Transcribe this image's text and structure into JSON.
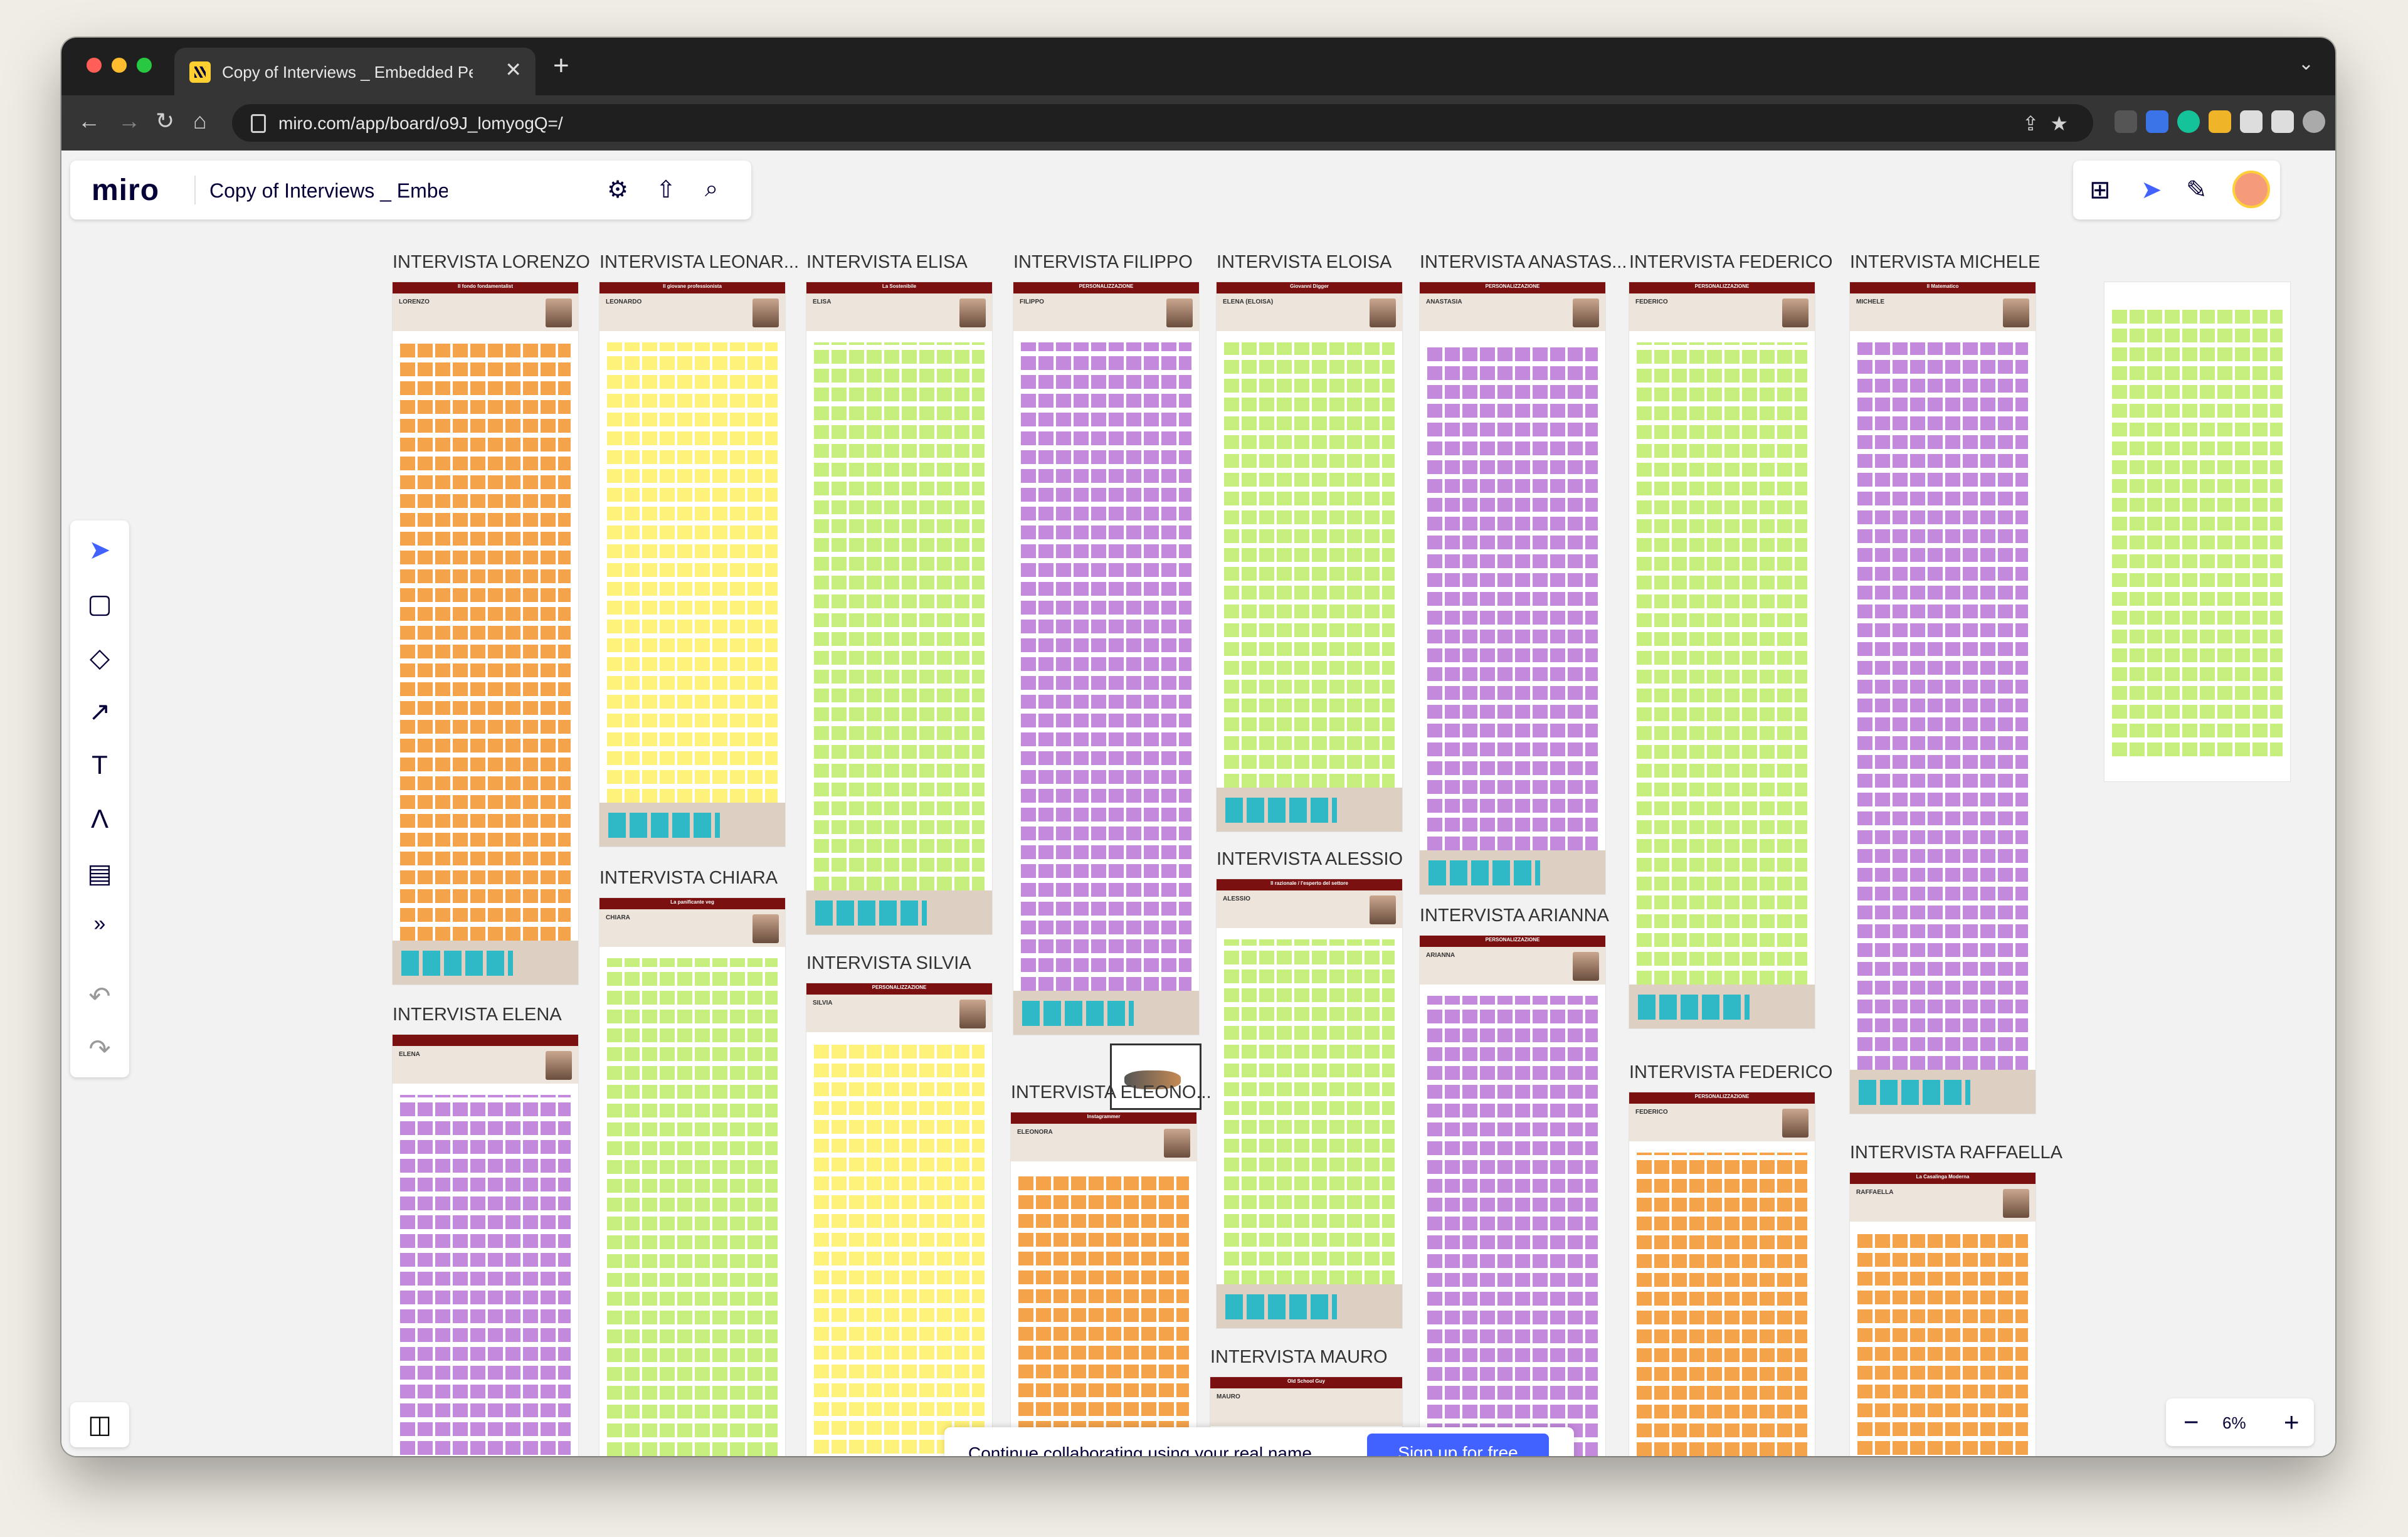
{
  "browser": {
    "tab_title": "Copy of Interviews _ Embedded Per",
    "new_tab_symbol": "+",
    "close_symbol": "✕",
    "url": "miro.com/app/board/o9J_lomyogQ=/"
  },
  "miro": {
    "logo": "miro",
    "board_name": "Copy of Interviews _ Embedded Per...",
    "zoom": "6%",
    "banner_text": "Continue collaborating using your real name.",
    "signup_label": "Sign up for free"
  },
  "frames": [
    {
      "title": "INTERVISTA LORENZO",
      "header": "Il fondo fondamentalist",
      "name": "LORENZO"
    },
    {
      "title": "INTERVISTA LEONAR...",
      "header": "Il giovane professionista",
      "name": "LEONARDO"
    },
    {
      "title": "INTERVISTA ELISA",
      "header": "La Sostenibile",
      "name": "ELISA"
    },
    {
      "title": "INTERVISTA FILIPPO",
      "header": "PERSONALIZZAZIONE",
      "name": "FILIPPO"
    },
    {
      "title": "INTERVISTA ELOISA",
      "header": "Giovanni Digger",
      "name": "ELENA (ELOISA)"
    },
    {
      "title": "INTERVISTA ANASTAS...",
      "header": "PERSONALIZZAZIONE",
      "name": "ANASTASIA"
    },
    {
      "title": "INTERVISTA FEDERICO",
      "header": "PERSONALIZZAZIONE",
      "name": "FEDERICO"
    },
    {
      "title": "INTERVISTA MICHELE",
      "header": "Il Matematico",
      "name": "MICHELE"
    },
    {
      "title": "INTERVISTA ELENA",
      "header": "",
      "name": "ELENA"
    },
    {
      "title": "INTERVISTA CHIARA",
      "header": "La panificante veg",
      "name": "CHIARA"
    },
    {
      "title": "INTERVISTA SILVIA",
      "header": "PERSONALIZZAZIONE",
      "name": "SILVIA"
    },
    {
      "title": "INTERVISTA ELEONO...",
      "header": "Instagrammer",
      "name": "ELEONORA"
    },
    {
      "title": "INTERVISTA ALESSIO",
      "header": "Il razionale / l'esperto del settore",
      "name": "ALESSIO"
    },
    {
      "title": "INTERVISTA ARIANNA",
      "header": "PERSONALIZZAZIONE",
      "name": "ARIANNA"
    },
    {
      "title": "INTERVISTA FEDERICO",
      "header": "PERSONALIZZAZIONE",
      "name": "FEDERICO"
    },
    {
      "title": "INTERVISTA RAFFAELLA",
      "header": "La Casalinga Moderna",
      "name": "RAFFAELLA"
    },
    {
      "title": "INTERVISTA MAURO",
      "header": "Old School Guy",
      "name": "MAURO"
    }
  ],
  "colors": {
    "frame_header": "#7a1010",
    "sticky_orange": "#f5a24b",
    "sticky_yellow": "#fff27a",
    "sticky_green": "#c6ef7e",
    "sticky_purple": "#c389dd",
    "sticky_teal": "#2fb9c6",
    "signup_blue": "#4262ff"
  }
}
